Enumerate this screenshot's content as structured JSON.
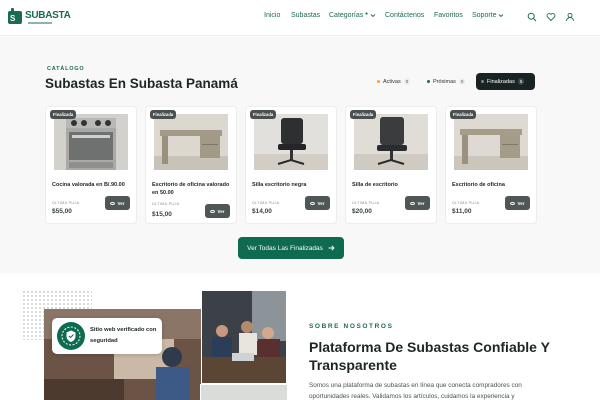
{
  "header": {
    "logo_text": "SUBASTA",
    "nav": [
      {
        "label": "Inicio"
      },
      {
        "label": "Subastas"
      },
      {
        "label": "Categorías"
      },
      {
        "label": "Contáctenos"
      },
      {
        "label": "Favoritos"
      },
      {
        "label": "Soporte"
      }
    ],
    "icons": [
      "search-icon",
      "heart-icon",
      "user-icon"
    ],
    "accent": "#1b6b4f"
  },
  "catalog": {
    "eyebrow": "CATÁLOGO",
    "title": "Subastas En Subasta Panamá",
    "filters": [
      {
        "label": "Activas",
        "count": "0",
        "dot_color": "#f0a53c"
      },
      {
        "label": "Próximas",
        "count": "0",
        "dot_color": "#1b6b4f"
      },
      {
        "label": "Finalizadas",
        "count": "5",
        "dot_color": "#7a8482"
      }
    ],
    "cards": [
      {
        "badge": "Finalizada",
        "name": "Cocina valorada en B/.90.00",
        "ultima_label": "ÚLTIMA PUJA",
        "price": "$55,00",
        "button": "Ver"
      },
      {
        "badge": "Finalizada",
        "name": "Escritorio de oficina valorado en 50.00",
        "ultima_label": "ÚLTIMA PUJA",
        "price": "$15,00",
        "button": "Ver"
      },
      {
        "badge": "Finalizada",
        "name": "Silla escritorio negra",
        "ultima_label": "ÚLTIMA PUJA",
        "price": "$14,00",
        "button": "Ver"
      },
      {
        "badge": "Finalizada",
        "name": "Silla de escritorio",
        "ultima_label": "ÚLTIMA PUJA",
        "price": "$20,00",
        "button": "Ver"
      },
      {
        "badge": "Finalizada",
        "name": "Escritorio de oficina",
        "ultima_label": "ÚLTIMA PUJA",
        "price": "$11,00",
        "button": "Ver"
      }
    ],
    "cta": "Ver Todas Las Finalizadas"
  },
  "about": {
    "badge_text": "Sitio web verificado con seguridad",
    "eyebrow": "SOBRE NOSOTROS",
    "title": "Plataforma De Subastas Confiable Y Transparente",
    "text": "Somos una plataforma de subastas en línea que conecta compradores con oportunidades reales. Validamos los artículos, cuidamos la experiencia y"
  }
}
